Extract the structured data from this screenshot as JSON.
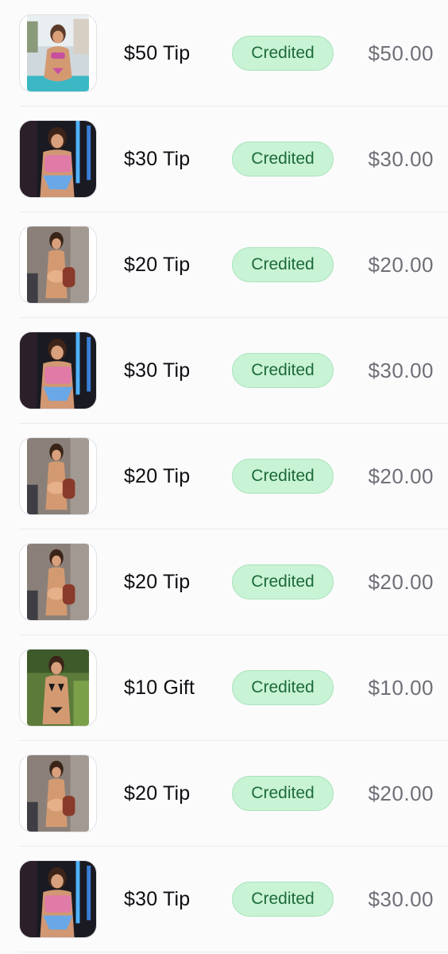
{
  "colors": {
    "badge_bg": "#c9f3d5",
    "badge_text": "#1c6a39",
    "amount_text": "#6f6f78"
  },
  "transactions": [
    {
      "title": "$50 Tip",
      "status": "Credited",
      "amount": "$50.00",
      "thumb": "pool"
    },
    {
      "title": "$30 Tip",
      "status": "Credited",
      "amount": "$30.00",
      "thumb": "neon"
    },
    {
      "title": "$20 Tip",
      "status": "Credited",
      "amount": "$20.00",
      "thumb": "room"
    },
    {
      "title": "$30 Tip",
      "status": "Credited",
      "amount": "$30.00",
      "thumb": "neon"
    },
    {
      "title": "$20 Tip",
      "status": "Credited",
      "amount": "$20.00",
      "thumb": "room"
    },
    {
      "title": "$20 Tip",
      "status": "Credited",
      "amount": "$20.00",
      "thumb": "room"
    },
    {
      "title": "$10 Gift",
      "status": "Credited",
      "amount": "$10.00",
      "thumb": "garden"
    },
    {
      "title": "$20 Tip",
      "status": "Credited",
      "amount": "$20.00",
      "thumb": "room"
    },
    {
      "title": "$30 Tip",
      "status": "Credited",
      "amount": "$30.00",
      "thumb": "neon"
    }
  ]
}
